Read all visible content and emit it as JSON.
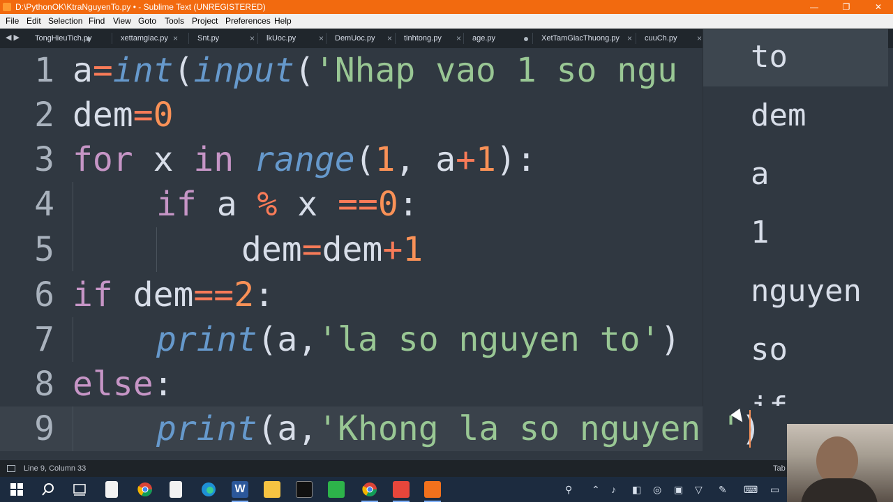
{
  "window": {
    "title": "D:\\PythonOK\\KtraNguyenTo.py • - Sublime Text (UNREGISTERED)",
    "minimize": "—",
    "restore": "❐",
    "close": "✕"
  },
  "menu": [
    "File",
    "Edit",
    "Selection",
    "Find",
    "View",
    "Goto",
    "Tools",
    "Project",
    "Preferences",
    "Help"
  ],
  "tabs": [
    {
      "label": "TongHieuTich.py",
      "state": "modified"
    },
    {
      "label": "xettamgiac.py",
      "state": "close"
    },
    {
      "label": "Snt.py",
      "state": "close"
    },
    {
      "label": "lkUoc.py",
      "state": "close"
    },
    {
      "label": "DemUoc.py",
      "state": "close"
    },
    {
      "label": "tinhtong.py",
      "state": "close"
    },
    {
      "label": "age.py",
      "state": "modified"
    },
    {
      "label": "XetTamGiacThuong.py",
      "state": "close"
    },
    {
      "label": "cuuCh.py",
      "state": "close"
    }
  ],
  "tab_nav": "◀ ▶",
  "editor": {
    "line_numbers": [
      "1",
      "2",
      "3",
      "4",
      "5",
      "6",
      "7",
      "8",
      "9"
    ],
    "lines": [
      {
        "n": "1"
      },
      {
        "n": "2"
      },
      {
        "n": "3"
      },
      {
        "n": "4"
      },
      {
        "n": "5"
      },
      {
        "n": "6"
      },
      {
        "n": "7"
      },
      {
        "n": "8"
      },
      {
        "n": "9"
      }
    ],
    "tokens": {
      "l1_a": "a",
      "l1_eq": "=",
      "l1_int": "int",
      "l1_p1": "(",
      "l1_input": "input",
      "l1_p2": "(",
      "l1_str": "'Nhap vao 1 so ngu",
      "l2_dem": "dem",
      "l2_eq": "=",
      "l2_zero": "0",
      "l3_for": "for",
      "l3_x": " x ",
      "l3_in": "in",
      "l3_sp": " ",
      "l3_range": "range",
      "l3_p": "(",
      "l3_one": "1",
      "l3_comma": ", a",
      "l3_plus": "+",
      "l3_one2": "1",
      "l3_end": "):",
      "l4_if": "if",
      "l4_a": " a ",
      "l4_mod": "%",
      "l4_x": " x ",
      "l4_eqeq": "==",
      "l4_zero": "0",
      "l4_colon": ":",
      "l5_dem": "dem",
      "l5_eq": "=",
      "l5_dem2": "dem",
      "l5_plus": "+",
      "l5_one": "1",
      "l6_if": "if",
      "l6_dem": " dem",
      "l6_eqeq": "==",
      "l6_two": "2",
      "l6_colon": ":",
      "l7_print": "print",
      "l7_p": "(a,",
      "l7_str": "'la so nguyen to'",
      "l7_end": ")",
      "l8_else": "else",
      "l8_colon": ":",
      "l9_print": "print",
      "l9_p": "(a,",
      "l9_str": "'Khong la so nguyen ",
      "l9_q": "'",
      "l9_end": ")"
    }
  },
  "autocomplete": [
    "to",
    "dem",
    "a",
    "1",
    "nguyen",
    "so",
    "if"
  ],
  "status": {
    "position": "Line 9, Column 33",
    "tab_info": "Tab"
  },
  "taskbar": {
    "tray_icons": [
      "people-icon",
      "chevron-up-icon",
      "volume-icon",
      "network-icon",
      "meet-icon",
      "pen-icon",
      "keyboard-icon"
    ]
  },
  "colors": {
    "titlebar": "#f26a0f",
    "editor_bg": "#303841",
    "keyword": "#c695c6",
    "function": "#6699cc",
    "string": "#99c794",
    "number": "#f99157"
  }
}
